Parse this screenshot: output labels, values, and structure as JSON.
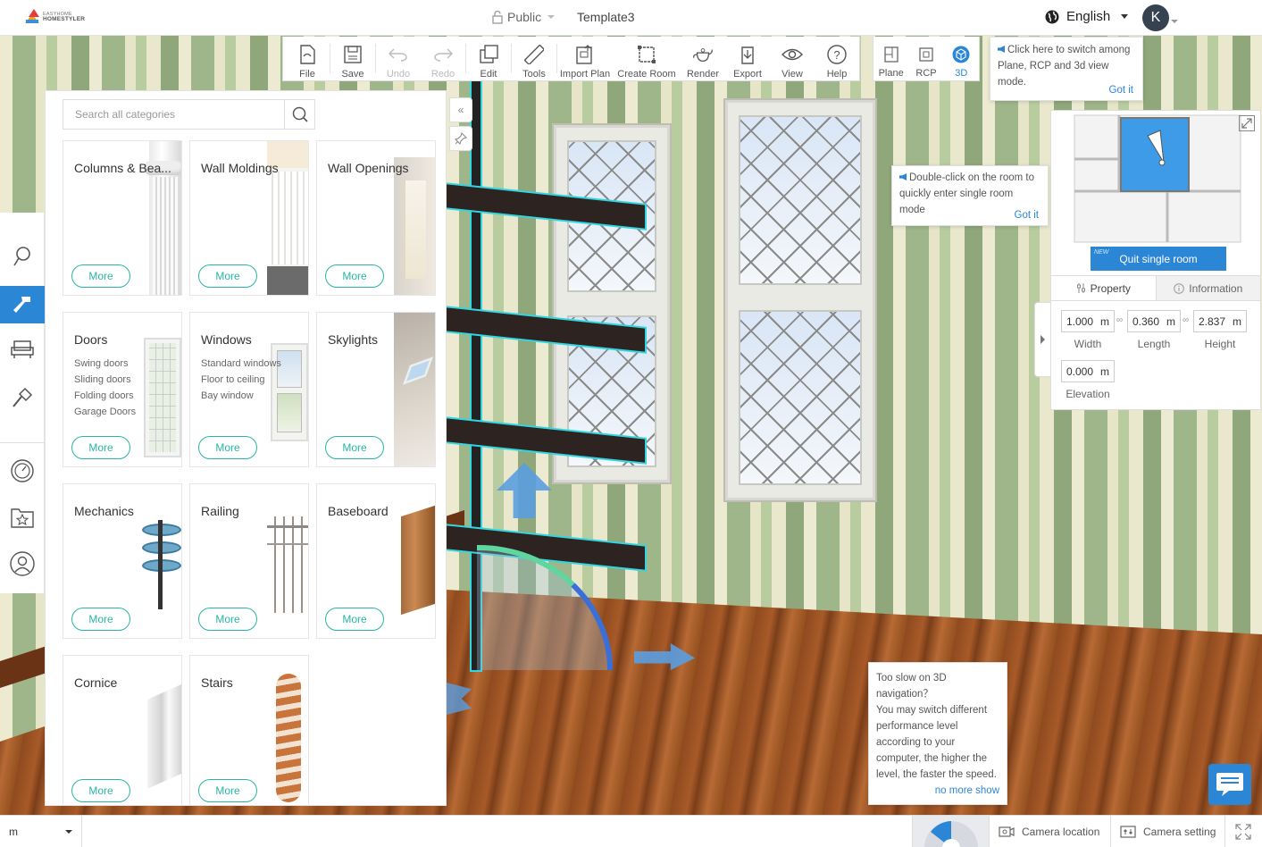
{
  "header": {
    "brand_line1": "EASYHOME",
    "brand_line2": "HOMESTYLER",
    "visibility": "Public",
    "doc_title": "Template3",
    "language": "English",
    "avatar_initial": "K"
  },
  "toolbar": {
    "items": [
      {
        "label": "File",
        "icon": "file-icon"
      },
      {
        "label": "Save",
        "icon": "save-icon"
      },
      {
        "label": "Undo",
        "icon": "undo-icon",
        "disabled": true
      },
      {
        "label": "Redo",
        "icon": "redo-icon",
        "disabled": true
      },
      {
        "label": "Edit",
        "icon": "edit-icon"
      },
      {
        "label": "Tools",
        "icon": "ruler-icon"
      },
      {
        "label": "Import Plan",
        "icon": "import-plan-icon"
      },
      {
        "label": "Create Room",
        "icon": "create-room-icon"
      },
      {
        "label": "Render",
        "icon": "teapot-icon"
      },
      {
        "label": "Export",
        "icon": "export-icon"
      },
      {
        "label": "View",
        "icon": "eye-icon"
      },
      {
        "label": "Help",
        "icon": "help-icon"
      }
    ],
    "view_modes": [
      {
        "label": "Plane",
        "icon": "plane-icon"
      },
      {
        "label": "RCP",
        "icon": "rcp-icon"
      },
      {
        "label": "3D",
        "icon": "cube-icon",
        "active": true
      }
    ]
  },
  "tips": {
    "view_switch": "Click here to switch among Plane, RCP and 3d view mode.",
    "view_switch_ok": "Got it",
    "single_room": "Double-click on the room to quickly enter single room mode",
    "single_room_ok": "Got it",
    "speed_title": "Too slow on 3D navigation？",
    "speed_body": "You may switch different performance level according to your computer, the higher the level, the faster the speed.",
    "speed_dismiss": "no more show"
  },
  "catalog": {
    "search_placeholder": "Search all categories",
    "more_label": "More",
    "categories": [
      {
        "title": "Columns & Bea...",
        "subs": []
      },
      {
        "title": "Wall Moldings",
        "subs": []
      },
      {
        "title": "Wall Openings",
        "subs": []
      },
      {
        "title": "Doors",
        "subs": [
          "Swing doors",
          "Sliding doors",
          "Folding doors",
          "Garage Doors"
        ]
      },
      {
        "title": "Windows",
        "subs": [
          "Standard windows",
          "Floor to ceiling",
          "Bay window"
        ]
      },
      {
        "title": "Skylights",
        "subs": []
      },
      {
        "title": "Mechanics",
        "subs": []
      },
      {
        "title": "Railing",
        "subs": []
      },
      {
        "title": "Baseboard",
        "subs": []
      },
      {
        "title": "Cornice",
        "subs": []
      },
      {
        "title": "Stairs",
        "subs": []
      }
    ]
  },
  "minimap": {
    "badge": "NEW",
    "quit_label": "Quit single room"
  },
  "properties": {
    "tab_property": "Property",
    "tab_information": "Information",
    "unit": "m",
    "width": {
      "value": "1.000",
      "label": "Width"
    },
    "length": {
      "value": "0.360",
      "label": "Length"
    },
    "height": {
      "value": "2.837",
      "label": "Height"
    },
    "elevation": {
      "value": "0.000",
      "label": "Elevation"
    }
  },
  "bottom": {
    "unit": "m",
    "camera_location": "Camera location",
    "camera_setting": "Camera setting"
  },
  "colors": {
    "accent": "#2b86d6",
    "more_button": "#2bb5a5",
    "selection_outline": "#33d6e0"
  }
}
